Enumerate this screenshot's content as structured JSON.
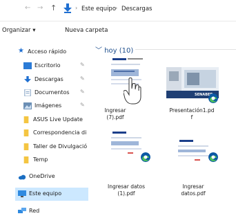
{
  "address": {
    "path": [
      "Este equipo",
      "Descargas"
    ],
    "separator": "›"
  },
  "toolbar": {
    "organize_label": "Organizar ▾",
    "new_folder_label": "Nueva carpeta"
  },
  "sidebar": {
    "items": [
      {
        "label": "Acceso rápido",
        "icon": "star-icon"
      },
      {
        "label": "Escritorio",
        "icon": "desktop-folder-icon",
        "pinned": true
      },
      {
        "label": "Descargas",
        "icon": "download-icon",
        "pinned": true
      },
      {
        "label": "Documentos",
        "icon": "documents-icon",
        "pinned": true
      },
      {
        "label": "Imágenes",
        "icon": "pictures-icon",
        "pinned": true
      },
      {
        "label": "ASUS Live Update",
        "icon": "folder-icon"
      },
      {
        "label": "Correspondencia di",
        "icon": "folder-icon"
      },
      {
        "label": "Taller de Divulgació",
        "icon": "folder-icon"
      },
      {
        "label": "Temp",
        "icon": "folder-icon"
      },
      {
        "label": "OneDrive",
        "icon": "cloud-icon"
      },
      {
        "label": "Este equipo",
        "icon": "computer-icon",
        "selected": true
      },
      {
        "label": "Red",
        "icon": "network-icon"
      }
    ],
    "pin_glyph": "✎"
  },
  "content": {
    "group_header": "hoy (10)",
    "files": [
      {
        "name_line1": "Ingresar",
        "name_line2": "(7).pdf",
        "type": "pdf"
      },
      {
        "name_line1": "Presentación1.pd",
        "name_line2": "f",
        "type": "pdf"
      },
      {
        "name_line1": "Ingresar datos",
        "name_line2": "(1).pdf",
        "type": "pdf"
      },
      {
        "name_line1": "Ingresar",
        "name_line2": "datos.pdf",
        "type": "pdf"
      }
    ],
    "thumbnail_caption": "SENABED"
  },
  "colors": {
    "selection": "#cce8ff",
    "accent": "#0067c0",
    "folder": "#f4c542",
    "edge_blue": "#0c59a4",
    "edge_green": "#4dc15b"
  }
}
